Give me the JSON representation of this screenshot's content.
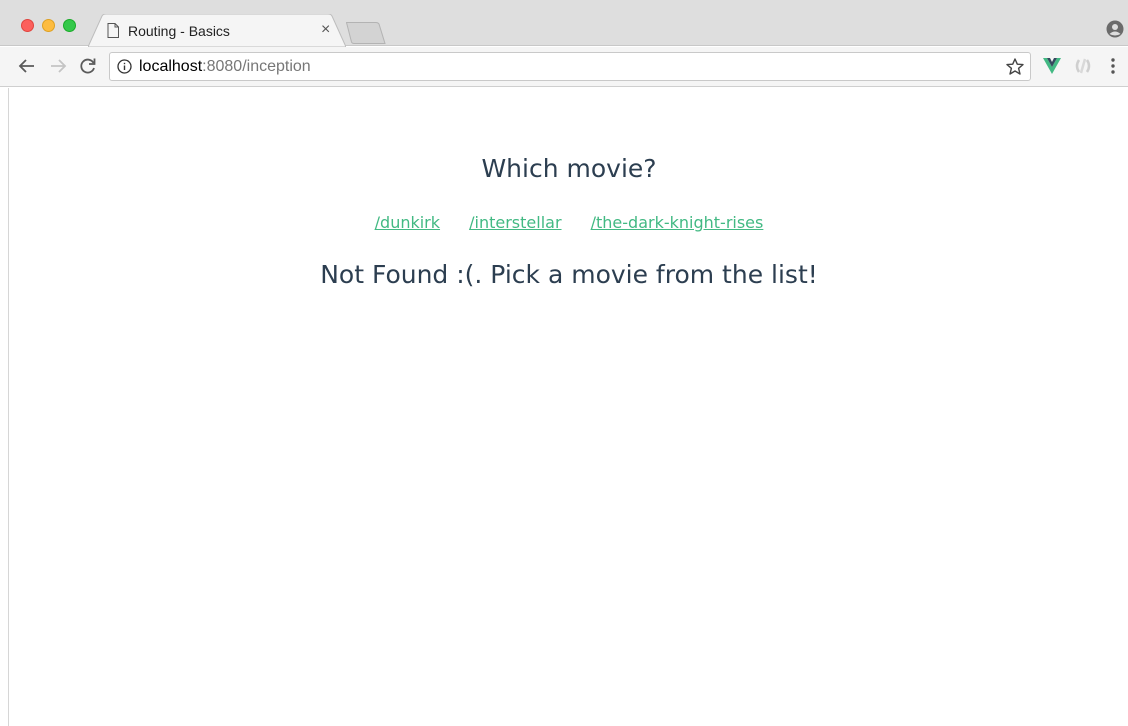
{
  "browser": {
    "tab_title": "Routing - Basics",
    "tab_close": "×",
    "url_host": "localhost",
    "url_rest": ":8080/inception"
  },
  "icons": {
    "page": "page-icon",
    "info": "info-icon",
    "star": "star-icon",
    "vue": "vue-devtools-icon",
    "extension": "extension-icon",
    "menu": "kebab-menu-icon",
    "profile": "profile-icon"
  },
  "colors": {
    "link": "#42b983",
    "text": "#2c3e50"
  },
  "page": {
    "heading": "Which movie?",
    "links": [
      {
        "label": "/dunkirk"
      },
      {
        "label": "/interstellar"
      },
      {
        "label": "/the-dark-knight-rises"
      }
    ],
    "message": "Not Found :(. Pick a movie from the list!"
  }
}
